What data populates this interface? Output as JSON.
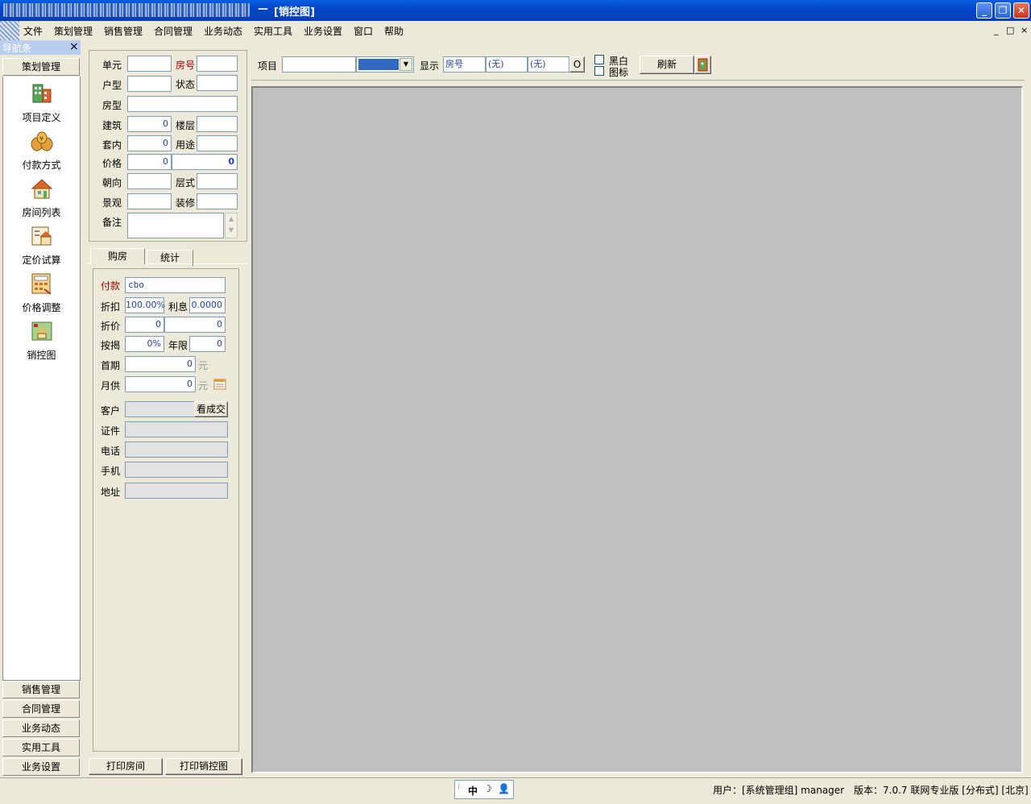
{
  "window": {
    "title_separator": "—",
    "title": "[销控图]",
    "controls": [
      "minimize",
      "restore",
      "close"
    ]
  },
  "menu": {
    "items": [
      "文件",
      "策划管理",
      "销售管理",
      "合同管理",
      "业务动态",
      "实用工具",
      "业务设置",
      "窗口",
      "帮助"
    ],
    "mdi_controls": [
      "_",
      "□",
      "×"
    ]
  },
  "navigator": {
    "title": "导航条",
    "close": "×",
    "active_group": "策划管理",
    "items": [
      {
        "label": "项目定义",
        "icon": "building-icon"
      },
      {
        "label": "付款方式",
        "icon": "money-bags-icon"
      },
      {
        "label": "房间列表",
        "icon": "house-icon"
      },
      {
        "label": "定价试算",
        "icon": "house-calc-icon"
      },
      {
        "label": "价格调整",
        "icon": "calculator-icon"
      },
      {
        "label": "销控图",
        "icon": "map-icon"
      }
    ],
    "groups": [
      "销售管理",
      "合同管理",
      "业务动态",
      "实用工具",
      "业务设置"
    ]
  },
  "property": {
    "unit_label": "单元",
    "room_no_label": "房号",
    "house_type_label": "户型",
    "status_label": "状态",
    "room_type_label": "房型",
    "build_area_label": "建筑",
    "build_area": "0",
    "floor_label": "楼层",
    "inner_area_label": "套内",
    "inner_area": "0",
    "usage_label": "用途",
    "price_label": "价格",
    "price": "0",
    "total": "0",
    "orientation_label": "朝向",
    "layer_label": "层式",
    "view_label": "景观",
    "decor_label": "装修",
    "remark_label": "备注"
  },
  "tabs": [
    "购房",
    "统计"
  ],
  "purchase": {
    "payment_label": "付款",
    "payment_value": "cbo",
    "discount_label": "折扣",
    "discount_value": "100.00%",
    "interest_label": "利息",
    "interest_value": "0.0000",
    "discounted_price_label": "折价",
    "discounted_price": "0",
    "discounted_total": "0",
    "mortgage_label": "按揭",
    "mortgage_value": "0%",
    "years_label": "年限",
    "years_value": "0",
    "down_payment_label": "首期",
    "down_payment": "0",
    "down_unit": "元",
    "monthly_label": "月供",
    "monthly": "0",
    "monthly_unit": "元",
    "customer_label": "客户",
    "view_deal_button": "看成交",
    "id_label": "证件",
    "phone_label": "电话",
    "mobile_label": "手机",
    "address_label": "地址"
  },
  "bottom_buttons": {
    "print_room": "打印房间",
    "print_chart": "打印销控图"
  },
  "toolbar": {
    "project_label": "项目",
    "display_label": "显示",
    "display_fields": [
      "房号",
      "(无)",
      "(无)"
    ],
    "circle_button": "O",
    "bw_label": "黑白",
    "icon_label": "图标",
    "refresh_label": "刷新"
  },
  "status": {
    "ime_text": "中",
    "user": "用户：[系统管理组] manager",
    "version": "版本：7.0.7 联网专业版 [分布式] [北京]"
  },
  "colors": {
    "titlebar": "#0347c9",
    "canvas": "#c0c0c0",
    "accent_red": "#a00000",
    "value_blue": "#1d3fb0"
  }
}
